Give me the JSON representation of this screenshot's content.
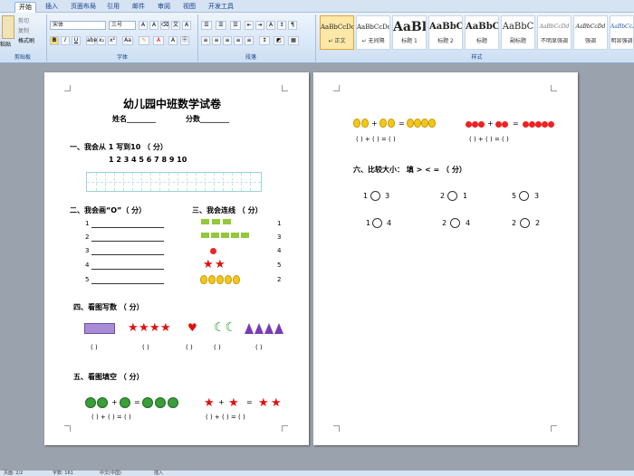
{
  "tabs": [
    "开始",
    "插入",
    "页面布局",
    "引用",
    "邮件",
    "审阅",
    "视图",
    "开发工具"
  ],
  "clipboard": {
    "paste": "粘贴",
    "cut": "剪切",
    "copy": "复制",
    "painter": "格式刷",
    "label": "剪贴板"
  },
  "font": {
    "name": "宋体",
    "size": "三号",
    "label": "字体"
  },
  "paragraph": {
    "label": "段落"
  },
  "styles": {
    "label": "样式",
    "items": [
      {
        "sample": "AaBbCcDc",
        "name": "↵ 正文"
      },
      {
        "sample": "AaBbCcDc",
        "name": "↵ 无间隔"
      },
      {
        "sample": "AaBl",
        "name": "标题 1"
      },
      {
        "sample": "AaBbC",
        "name": "标题 2"
      },
      {
        "sample": "AaBbC",
        "name": "标题"
      },
      {
        "sample": "AaBbC",
        "name": "副标题"
      },
      {
        "sample": "AaBbCcDd",
        "name": "不明显强调"
      },
      {
        "sample": "AaBbCcDd",
        "name": "强调"
      },
      {
        "sample": "AaBbCcDd",
        "name": "明显强调"
      }
    ]
  },
  "page1": {
    "title": "幼儿园中班数学试卷",
    "name_label": "姓名________",
    "score_label": "分数________",
    "s1": "一、我会从 1 写到10 （  分）",
    "numbers": "1    2    3    4    5    6    7    8    9    10",
    "s2": "二、我会画“O”（  分）",
    "s3": "三、我会连线 （  分）",
    "lines": [
      "1",
      "2",
      "3",
      "4",
      "5"
    ],
    "right_nums": [
      "1",
      "3",
      "4",
      "5",
      "2"
    ],
    "s4": "四、看图写数 （  分）",
    "paren": "(     )",
    "s5": "五、看图填空 （  分）",
    "fill_a": "(    ) + (    ) = (    )",
    "fill_b": "(    ) + (    ) = (    )",
    "plus": "+",
    "eq": "="
  },
  "page2": {
    "fill_a": "(    ) + (    ) = (    )",
    "fill_b": "(    ) + (    ) = (    )",
    "plus": "+",
    "eq": "=",
    "s6": "六、比较大小： 填 > < = （    分）",
    "cmp": [
      [
        "1",
        "3"
      ],
      [
        "2",
        "1"
      ],
      [
        "5",
        "3"
      ],
      [
        "1",
        "4"
      ],
      [
        "2",
        "4"
      ],
      [
        "2",
        "2"
      ]
    ]
  },
  "status": {
    "page": "页面: 2/2",
    "words": "字数: 161",
    "lang": "中文(中国)",
    "mode": "插入"
  }
}
